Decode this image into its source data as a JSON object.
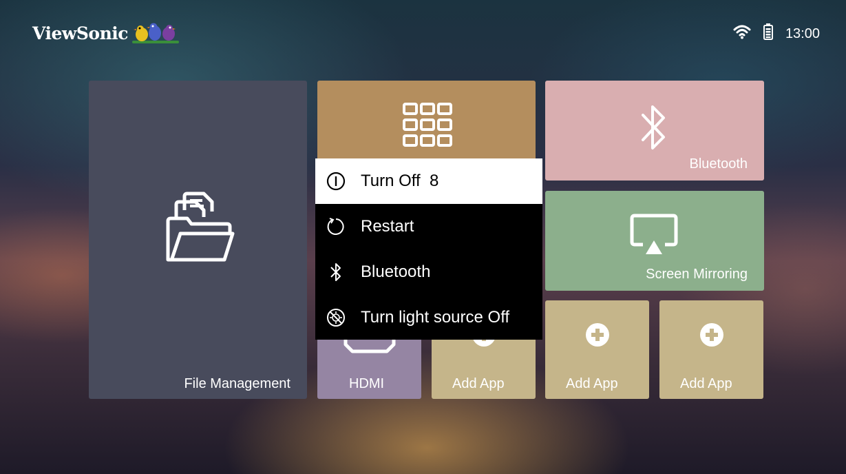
{
  "brand": {
    "name": "ViewSonic"
  },
  "status": {
    "time": "13:00",
    "wifi_icon": "wifi-icon",
    "battery_icon": "battery-icon"
  },
  "tiles": {
    "file_management": {
      "label": "File Management",
      "icon": "folder-icon"
    },
    "apps": {
      "label": "",
      "icon": "grid-icon"
    },
    "bluetooth": {
      "label": "Bluetooth",
      "icon": "bluetooth-icon"
    },
    "screen_mirroring": {
      "label": "Screen Mirroring",
      "icon": "screen-mirroring-icon"
    },
    "hdmi": {
      "label": "HDMI",
      "icon": "hdmi-icon"
    },
    "add_app_1": {
      "label": "Add App",
      "icon": "plus-icon"
    },
    "add_app_2": {
      "label": "Add App",
      "icon": "plus-icon"
    },
    "add_app_3": {
      "label": "Add App",
      "icon": "plus-icon"
    }
  },
  "power_menu": {
    "items": [
      {
        "label": "Turn Off  8",
        "icon": "power-icon",
        "selected": true
      },
      {
        "label": "Restart",
        "icon": "restart-icon",
        "selected": false
      },
      {
        "label": "Bluetooth",
        "icon": "bluetooth-icon",
        "selected": false
      },
      {
        "label": "Turn light source Off",
        "icon": "light-off-icon",
        "selected": false
      }
    ]
  },
  "colors": {
    "file_tile": "#484b5c",
    "apps_tile": "#b48e5e",
    "bluetooth_tile": "#d9aeb0",
    "mirror_tile": "#8caf8c",
    "hdmi_tile": "#9585a3",
    "add_tile": "#c5b58a",
    "menu_bg": "#000000",
    "menu_selected_bg": "#ffffff"
  }
}
